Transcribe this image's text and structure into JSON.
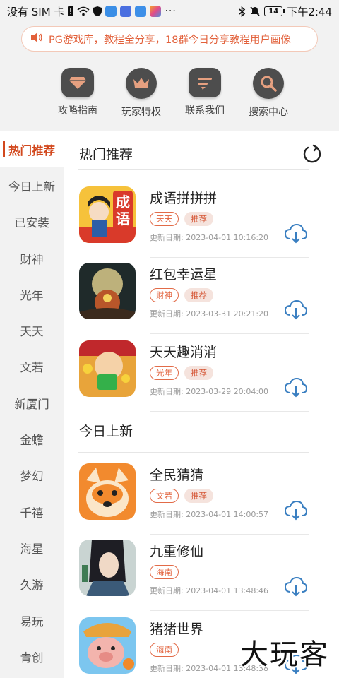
{
  "status_bar": {
    "carrier": "没有 SIM 卡",
    "battery": "14",
    "time": "下午2:44"
  },
  "notice": {
    "text": "PG游戏库，教程全分享，18群今日分享教程用户画像"
  },
  "top_nav": [
    {
      "label": "攻略指南",
      "icon": "diamond-icon"
    },
    {
      "label": "玩家特权",
      "icon": "crown-icon"
    },
    {
      "label": "联系我们",
      "icon": "chat-icon"
    },
    {
      "label": "搜索中心",
      "icon": "search-icon"
    }
  ],
  "sidebar": {
    "items": [
      "热门推荐",
      "今日上新",
      "已安装",
      "财神",
      "光年",
      "天天",
      "文若",
      "新厦门",
      "金蟾",
      "梦幻",
      "千禧",
      "海星",
      "久游",
      "易玩",
      "青创"
    ],
    "active_index": 0
  },
  "hot": {
    "title": "热门推荐",
    "apps": [
      {
        "name": "成语拼拼拼",
        "tags": [
          "天天",
          "推荐"
        ],
        "date_label": "更新日期:",
        "date": "2023-04-01 10:16:20",
        "icon_text": "成语"
      },
      {
        "name": "红包幸运星",
        "tags": [
          "财神",
          "推荐"
        ],
        "date_label": "更新日期:",
        "date": "2023-03-31 20:21:20"
      },
      {
        "name": "天天趣消消",
        "tags": [
          "光年",
          "推荐"
        ],
        "date_label": "更新日期:",
        "date": "2023-03-29 20:04:00"
      }
    ]
  },
  "new": {
    "title": "今日上新",
    "apps": [
      {
        "name": "全民猜猜",
        "tags": [
          "文若",
          "推荐"
        ],
        "date_label": "更新日期:",
        "date": "2023-04-01 14:00:57"
      },
      {
        "name": "九重修仙",
        "tags": [
          "海南"
        ],
        "date_label": "更新日期:",
        "date": "2023-04-01 13:48:46"
      },
      {
        "name": "猪猪世界",
        "tags": [
          "海南"
        ],
        "date_label": "更新日期:",
        "date": "2023-04-01 13:48:38"
      }
    ]
  },
  "watermark": "大玩客",
  "colors": {
    "accent": "#d2481d",
    "tag_outline": "#e26b48",
    "tag_fill_bg": "#f5e3dd",
    "nav_icon_bg": "#4d4d4d",
    "download_icon": "#3a7fc1"
  }
}
